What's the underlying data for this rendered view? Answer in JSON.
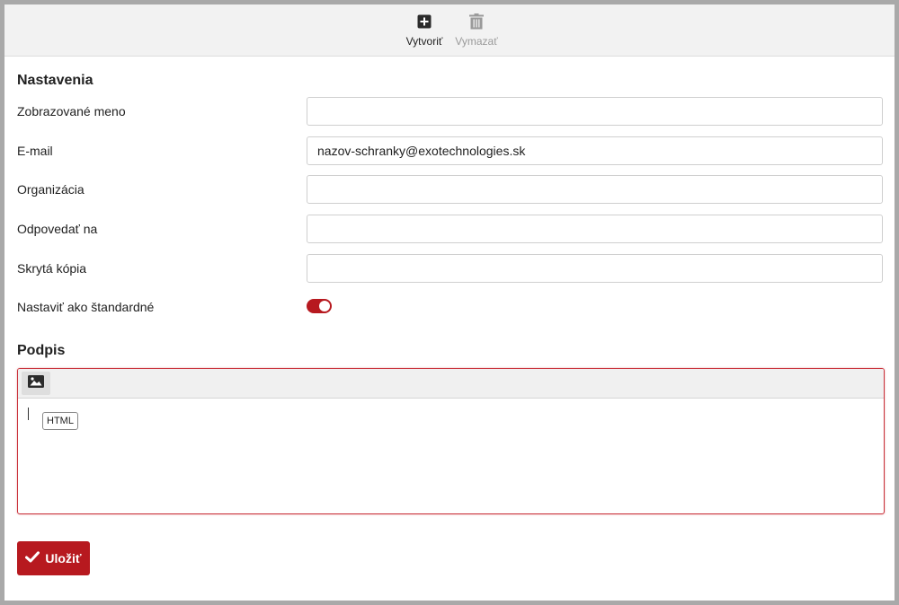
{
  "toolbar": {
    "create_label": "Vytvoriť",
    "delete_label": "Vymazať"
  },
  "settings": {
    "heading": "Nastavenia",
    "display_name": {
      "label": "Zobrazované meno",
      "value": ""
    },
    "email": {
      "label": "E-mail",
      "value": "nazov-schranky@exotechnologies.sk"
    },
    "organization": {
      "label": "Organizácia",
      "value": ""
    },
    "reply_to": {
      "label": "Odpovedať na",
      "value": ""
    },
    "bcc": {
      "label": "Skrytá kópia",
      "value": ""
    },
    "default": {
      "label": "Nastaviť ako štandardné",
      "checked": true
    }
  },
  "signature": {
    "heading": "Podpis",
    "html_badge": "HTML"
  },
  "save": {
    "label": "Uložiť"
  },
  "colors": {
    "accent": "#b7191f",
    "toolbar_bg": "#f2f2f2",
    "disabled_text": "#9a9a9a"
  }
}
